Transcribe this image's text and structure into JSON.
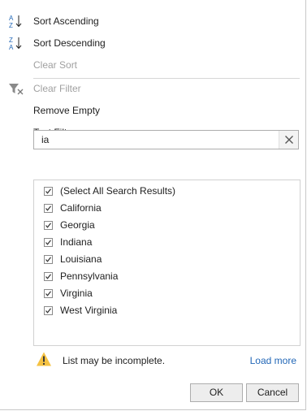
{
  "menu": {
    "sort_ascending": "Sort Ascending",
    "sort_descending": "Sort Descending",
    "clear_sort": "Clear Sort",
    "clear_filter": "Clear Filter",
    "remove_empty": "Remove Empty",
    "text_filters": "Text Filters"
  },
  "search": {
    "value": "ia"
  },
  "items": [
    {
      "label": "(Select All Search Results)",
      "checked": true
    },
    {
      "label": "California",
      "checked": true
    },
    {
      "label": "Georgia",
      "checked": true
    },
    {
      "label": "Indiana",
      "checked": true
    },
    {
      "label": "Louisiana",
      "checked": true
    },
    {
      "label": "Pennsylvania",
      "checked": true
    },
    {
      "label": "Virginia",
      "checked": true
    },
    {
      "label": "West Virginia",
      "checked": true
    }
  ],
  "footer": {
    "warning": "List may be incomplete.",
    "load_more": "Load more",
    "ok": "OK",
    "cancel": "Cancel"
  },
  "colors": {
    "accent_blue": "#2267b7",
    "warning_yellow": "#f5c242",
    "disabled_text": "#a0a0a0"
  }
}
